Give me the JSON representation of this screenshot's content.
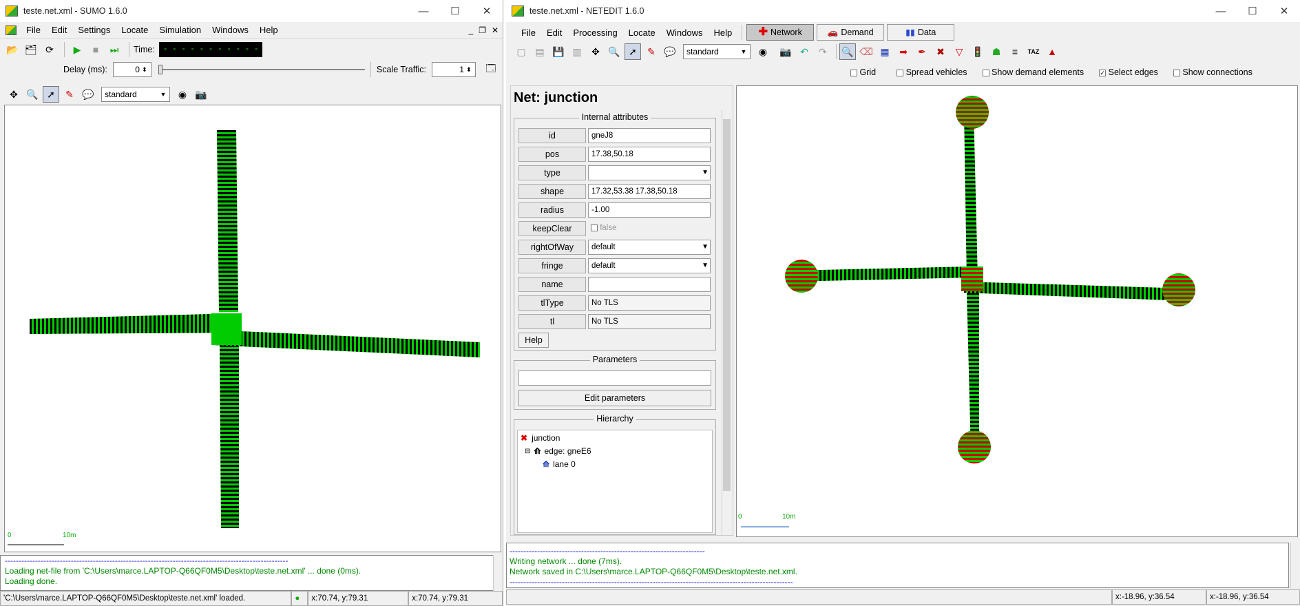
{
  "sumo": {
    "title": "teste.net.xml - SUMO 1.6.0",
    "window_controls": {
      "minimize": "—",
      "maximize": "☐",
      "close": "✕"
    },
    "mdi_controls": {
      "minimize": "_",
      "restore": "❐",
      "close": "✕"
    },
    "menu": [
      "File",
      "Edit",
      "Settings",
      "Locate",
      "Simulation",
      "Windows",
      "Help"
    ],
    "time_label": "Time:",
    "time_value": "- - - - - - - - - - - - - -",
    "delay_label": "Delay (ms):",
    "delay_value": "0",
    "scale_label": "Scale Traffic:",
    "scale_value": "1",
    "scheme": "standard",
    "scale_bar": {
      "left": "0",
      "right": "10m"
    },
    "log": [
      "-------------------------------------------------------------------------------------------------------",
      "Loading net-file from 'C:\\Users\\marce.LAPTOP-Q66QF0M5\\Desktop\\teste.net.xml' ... done (0ms).",
      "Loading done."
    ],
    "status": {
      "message": "'C:\\Users\\marce.LAPTOP-Q66QF0M5\\Desktop\\teste.net.xml' loaded.",
      "coord1": "x:70.74, y:79.31",
      "coord2": "x:70.74, y:79.31"
    }
  },
  "netedit": {
    "title": "teste.net.xml - NETEDIT 1.6.0",
    "window_controls": {
      "minimize": "—",
      "maximize": "☐",
      "close": "✕"
    },
    "menu": [
      "File",
      "Edit",
      "Processing",
      "Locate",
      "Windows",
      "Help"
    ],
    "supermodes": [
      "Network",
      "Demand",
      "Data"
    ],
    "scheme": "standard",
    "options": [
      {
        "label": "Grid",
        "checked": false
      },
      {
        "label": "Spread vehicles",
        "checked": false
      },
      {
        "label": "Show demand elements",
        "checked": false
      },
      {
        "label": "Select edges",
        "checked": true
      },
      {
        "label": "Show connections",
        "checked": false
      }
    ],
    "panel_title": "Net: junction",
    "internal_attributes_title": "Internal attributes",
    "attributes": [
      {
        "name": "id",
        "value": "gneJ8",
        "kind": "text"
      },
      {
        "name": "pos",
        "value": "17.38,50.18",
        "kind": "text"
      },
      {
        "name": "type",
        "value": "",
        "kind": "select"
      },
      {
        "name": "shape",
        "value": "17.32,53.38 17.38,50.18",
        "kind": "text"
      },
      {
        "name": "radius",
        "value": "-1.00",
        "kind": "text"
      },
      {
        "name": "keepClear",
        "value": "false",
        "kind": "check"
      },
      {
        "name": "rightOfWay",
        "value": "default",
        "kind": "select"
      },
      {
        "name": "fringe",
        "value": "default",
        "kind": "select"
      },
      {
        "name": "name",
        "value": "",
        "kind": "text"
      },
      {
        "name": "tlType",
        "value": "No TLS",
        "kind": "ro"
      },
      {
        "name": "tl",
        "value": "No TLS",
        "kind": "ro"
      }
    ],
    "help_label": "Help",
    "parameters_title": "Parameters",
    "parameters_value": "",
    "edit_parameters_label": "Edit parameters",
    "hierarchy_title": "Hierarchy",
    "hierarchy": [
      {
        "label": "junction",
        "level": 0,
        "expander": ""
      },
      {
        "label": "edge: gneE6",
        "level": 1,
        "expander": "⊟"
      },
      {
        "label": "lane 0",
        "level": 2,
        "expander": ""
      }
    ],
    "scale_bar": {
      "left": "0",
      "right": "10m"
    },
    "log": [
      "-----------------------------------------------------------------------",
      "Writing network ... done (7ms).",
      "Network saved in C:\\Users\\marce.LAPTOP-Q66QF0M5\\Desktop\\teste.net.xml.",
      "-------------------------------------------------------------------------------------------------------"
    ],
    "status": {
      "coord1": "x:-18.96, y:36.54",
      "coord2": "x:-18.96, y:36.54"
    },
    "colors": {
      "lane_green": "#00cc00",
      "junction_red": "#cc0000",
      "log_green": "#008800"
    }
  }
}
